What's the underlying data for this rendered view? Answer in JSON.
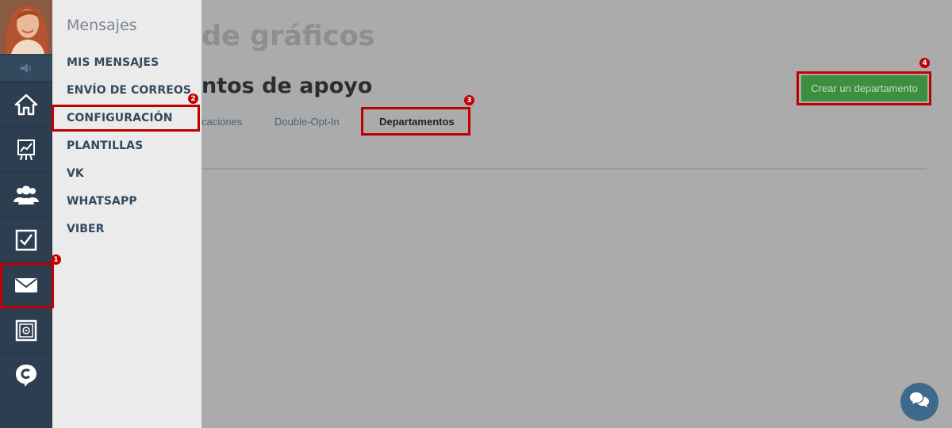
{
  "flyout": {
    "title": "Mensajes",
    "items": [
      {
        "label": "MIS MENSAJES"
      },
      {
        "label": "ENVÍO DE CORREOS"
      },
      {
        "label": "CONFIGURACIÓN"
      },
      {
        "label": "PLANTILLAS"
      },
      {
        "label": "VK"
      },
      {
        "label": "WHATSAPP"
      },
      {
        "label": "VIBER"
      }
    ]
  },
  "rail": {
    "icons": [
      "avatar",
      "speaker-icon",
      "home-icon",
      "chart-icon",
      "users-icon",
      "checkbox-icon",
      "mail-icon",
      "safe-icon",
      "chat-logo-icon"
    ]
  },
  "main": {
    "title_visible": "de gráficos",
    "section_visible": "ntos de apoyo",
    "tabs": [
      {
        "label": "caciones"
      },
      {
        "label": "Double-Opt-In"
      },
      {
        "label": "Departamentos",
        "active": true
      }
    ],
    "create_button": "Crear un departamento"
  },
  "annotations": {
    "badges": [
      "1",
      "2",
      "3",
      "4"
    ],
    "highlight_color": "#c00000"
  },
  "colors": {
    "rail_bg": "#2c3e50",
    "flyout_bg": "#ebebeb",
    "overlay_bg": "#ababab",
    "button_green": "#3e8e41"
  }
}
